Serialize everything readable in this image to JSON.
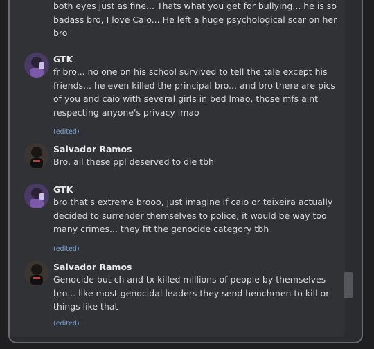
{
  "messages": [
    {
      "name": "",
      "text": "both eyes just as fine... Thats what you get for bullying... he is so badass bro, I love Caio... He left a huge psychological scar on her bro",
      "edited": ""
    },
    {
      "name": "GTK",
      "text": "fr bro... no one on his school survived to tell the tale except his friends... he even killed the principal bro... and bro there are pics of you and caio with several girls in bed lmao, those mfs aint respecting anyone's privacy lmao",
      "edited": "(edited)"
    },
    {
      "name": "Salvador Ramos",
      "text": "Bro, all these ppl deserved to die tbh",
      "edited": ""
    },
    {
      "name": "GTK",
      "text": "bro that's extreme brooo, just imagine if caio or teixeira actually decided to surrender themselves to police, it would be way too many crimes... they fit the genocide category tbh",
      "edited": "(edited)"
    },
    {
      "name": "Salvador Ramos",
      "text": "Genocide but ch and tx killed millions of people by themselves bro... like most genocidal leaders they send henchmen to kill or things like that",
      "edited": "(edited)"
    }
  ],
  "colors": {
    "background": "#1f1f21",
    "panel": "#313236",
    "link": "#6ea0d6",
    "gtk_avatar": "#6b4f8f",
    "salvador_avatar": "#3a3530"
  },
  "icons": [
    "gtk-avatar",
    "salvador-ramos-avatar"
  ]
}
